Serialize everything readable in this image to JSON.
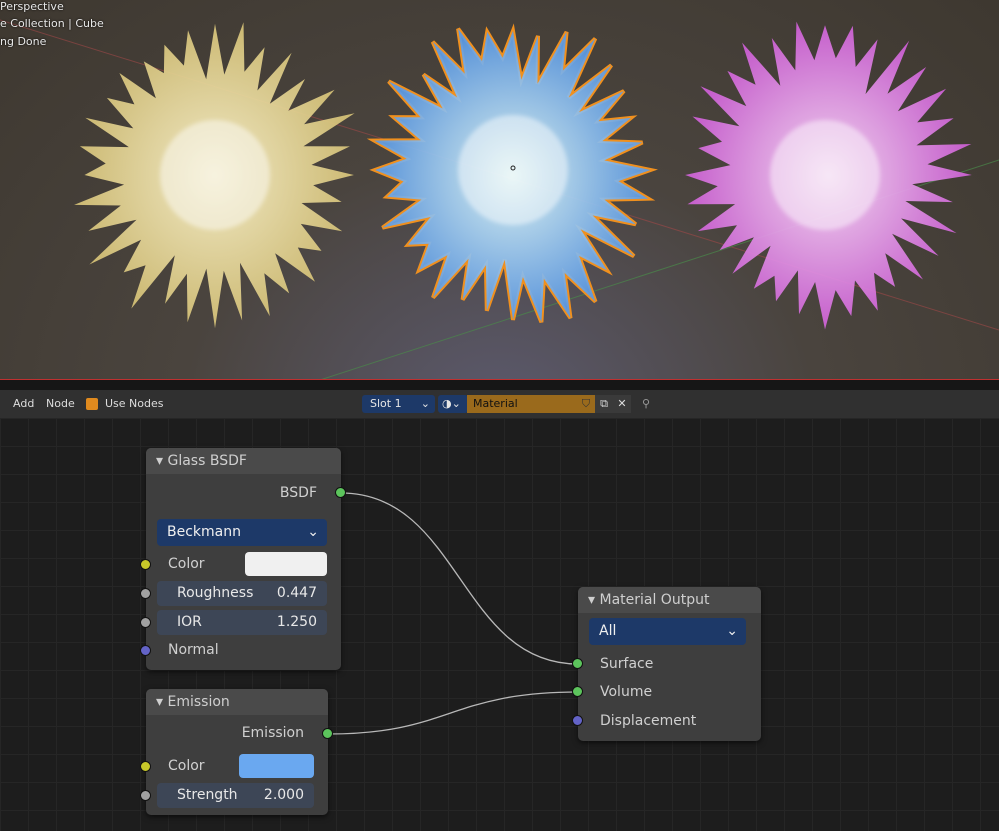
{
  "viewport": {
    "overlay_lines": [
      "Perspective",
      "e Collection | Cube",
      "ng Done"
    ],
    "flowers": [
      {
        "color": "#f3e29a"
      },
      {
        "color": "#8cc8ff",
        "selected": true
      },
      {
        "color": "#f08cf0"
      }
    ]
  },
  "header": {
    "add": "Add",
    "node": "Node",
    "use_nodes_label": "Use Nodes",
    "use_nodes_checked": true,
    "slot": "Slot 1",
    "material": "Material",
    "material_color": "#9a6a1c"
  },
  "nodes": {
    "glass": {
      "title": "Glass BSDF",
      "output": "BSDF",
      "distribution": "Beckmann",
      "color_label": "Color",
      "color_value": "#f0f0f0",
      "roughness_label": "Roughness",
      "roughness": "0.447",
      "ior_label": "IOR",
      "ior": "1.250",
      "normal_label": "Normal"
    },
    "emission": {
      "title": "Emission",
      "output": "Emission",
      "color_label": "Color",
      "color_value": "#6aa8f0",
      "strength_label": "Strength",
      "strength": "2.000"
    },
    "output": {
      "title": "Material Output",
      "target": "All",
      "surface": "Surface",
      "volume": "Volume",
      "displacement": "Displacement"
    }
  },
  "colors": {
    "socket_shader": "#5cc45c",
    "socket_color": "#c7c729",
    "socket_float": "#a1a1a1",
    "socket_vector": "#6363c7"
  }
}
